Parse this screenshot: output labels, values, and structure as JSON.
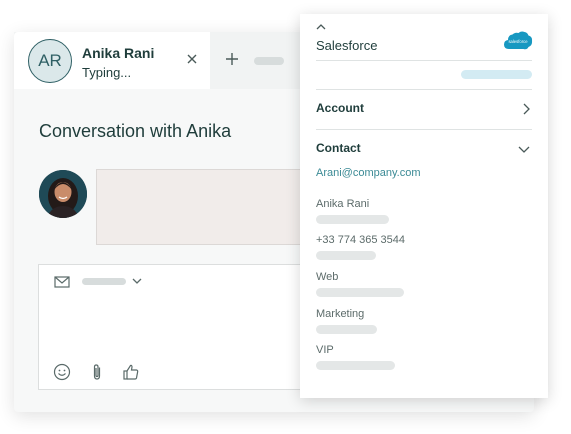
{
  "tab": {
    "initials": "AR",
    "name": "Anika Rani",
    "status": "Typing..."
  },
  "conversation": {
    "title": "Conversation with Anika"
  },
  "crm_panel": {
    "title": "Salesforce",
    "logo_text": "salesforce",
    "sections": [
      {
        "label": "Account",
        "expanded": false
      },
      {
        "label": "Contact",
        "expanded": true
      }
    ],
    "contact": {
      "email": "Arani@company.com",
      "fields": [
        {
          "value": "Anika Rani"
        },
        {
          "value": "+33 774 365 3544"
        },
        {
          "value": "Web"
        },
        {
          "value": "Marketing"
        },
        {
          "value": "VIP"
        }
      ]
    }
  },
  "colors": {
    "accent": "#2e5f64",
    "link": "#3b8a95",
    "salesforce_blue": "#1798c1"
  }
}
